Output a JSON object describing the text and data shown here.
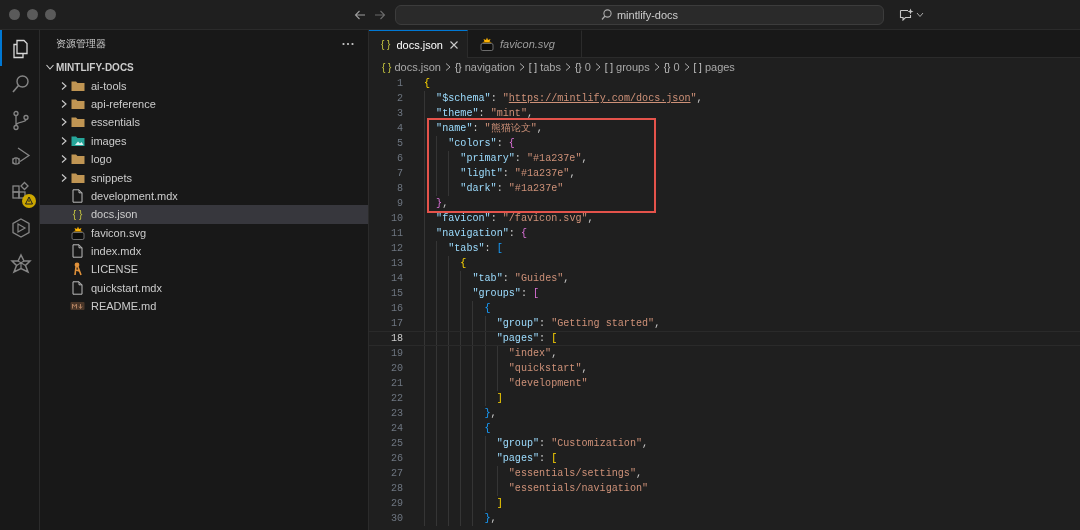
{
  "titlebar": {
    "command_center": "mintlify-docs"
  },
  "activity_bar": [
    {
      "kind": "explorer",
      "selected": true,
      "warning": false
    },
    {
      "kind": "search",
      "selected": false,
      "warning": false
    },
    {
      "kind": "source-control",
      "selected": false,
      "warning": false
    },
    {
      "kind": "run-debug",
      "selected": false,
      "warning": false
    },
    {
      "kind": "extensions",
      "selected": false,
      "warning": true
    },
    {
      "kind": "hexagon",
      "selected": false,
      "warning": false
    },
    {
      "kind": "knot",
      "selected": false,
      "warning": false
    }
  ],
  "explorer": {
    "title": "资源管理器",
    "root": {
      "label": "MINTLIFY-DOCS",
      "kind": "root",
      "expanded": true,
      "selected": false,
      "children": [
        {
          "label": "ai-tools",
          "kind": "folder",
          "expanded": false,
          "selected": false
        },
        {
          "label": "api-reference",
          "kind": "folder",
          "expanded": false,
          "selected": false
        },
        {
          "label": "essentials",
          "kind": "folder",
          "expanded": false,
          "selected": false
        },
        {
          "label": "images",
          "kind": "image-folder",
          "expanded": false,
          "selected": false
        },
        {
          "label": "logo",
          "kind": "folder",
          "expanded": false,
          "selected": false
        },
        {
          "label": "snippets",
          "kind": "folder",
          "expanded": false,
          "selected": false
        },
        {
          "label": "development.mdx",
          "kind": "file",
          "selected": false
        },
        {
          "label": "docs.json",
          "kind": "json",
          "glyph": "{ }",
          "selected": true
        },
        {
          "label": "favicon.svg",
          "kind": "svg",
          "selected": false
        },
        {
          "label": "index.mdx",
          "kind": "file",
          "selected": false
        },
        {
          "label": "LICENSE",
          "kind": "license",
          "selected": false
        },
        {
          "label": "quickstart.mdx",
          "kind": "file",
          "selected": false
        },
        {
          "label": "README.md",
          "kind": "markdown",
          "selected": false
        }
      ]
    }
  },
  "editor": {
    "tabs": [
      {
        "label": "docs.json",
        "kind": "json",
        "glyph": "{ }",
        "selected": true,
        "preview": false
      },
      {
        "label": "favicon.svg",
        "kind": "svg",
        "selected": false,
        "preview": true
      }
    ],
    "breadcrumbs": [
      {
        "glyph": "{ }",
        "label": "docs.json"
      },
      {
        "glyph": "{}",
        "label": "navigation"
      },
      {
        "glyph": "[ ]",
        "label": "tabs"
      },
      {
        "glyph": "{}",
        "label": "0"
      },
      {
        "glyph": "[ ]",
        "label": "groups"
      },
      {
        "glyph": "{}",
        "label": "0"
      },
      {
        "glyph": "[ ]",
        "label": "pages"
      }
    ],
    "lines": [
      {
        "number": "1",
        "current": false,
        "boxed": false,
        "tokens": [
          {
            "kind": "brace1",
            "text": "{"
          }
        ]
      },
      {
        "number": "2",
        "current": false,
        "boxed": false,
        "tokens": [
          {
            "kind": "key",
            "text": "  \"$schema\""
          },
          {
            "kind": "punct",
            "text": ": "
          },
          {
            "kind": "string",
            "text": "\""
          },
          {
            "kind": "link",
            "text": "https://mintlify.com/docs.json"
          },
          {
            "kind": "string",
            "text": "\""
          },
          {
            "kind": "punct",
            "text": ","
          }
        ]
      },
      {
        "number": "3",
        "current": false,
        "boxed": false,
        "tokens": [
          {
            "kind": "key",
            "text": "  \"theme\""
          },
          {
            "kind": "punct",
            "text": ": "
          },
          {
            "kind": "string",
            "text": "\"mint\""
          },
          {
            "kind": "punct",
            "text": ","
          }
        ]
      },
      {
        "number": "4",
        "current": false,
        "boxed": true,
        "tokens": [
          {
            "kind": "key",
            "text": "  \"name\""
          },
          {
            "kind": "punct",
            "text": ": "
          },
          {
            "kind": "string",
            "text": "\"熊猫论文\""
          },
          {
            "kind": "punct",
            "text": ","
          }
        ]
      },
      {
        "number": "5",
        "current": false,
        "boxed": true,
        "tokens": [
          {
            "kind": "key",
            "text": "    \"colors\""
          },
          {
            "kind": "punct",
            "text": ": "
          },
          {
            "kind": "brace2",
            "text": "{"
          }
        ]
      },
      {
        "number": "6",
        "current": false,
        "boxed": true,
        "tokens": [
          {
            "kind": "key",
            "text": "      \"primary\""
          },
          {
            "kind": "punct",
            "text": ": "
          },
          {
            "kind": "string",
            "text": "\"#1a237e\""
          },
          {
            "kind": "punct",
            "text": ","
          }
        ]
      },
      {
        "number": "7",
        "current": false,
        "boxed": true,
        "tokens": [
          {
            "kind": "key",
            "text": "      \"light\""
          },
          {
            "kind": "punct",
            "text": ": "
          },
          {
            "kind": "string",
            "text": "\"#1a237e\""
          },
          {
            "kind": "punct",
            "text": ","
          }
        ]
      },
      {
        "number": "8",
        "current": false,
        "boxed": true,
        "tokens": [
          {
            "kind": "key",
            "text": "      \"dark\""
          },
          {
            "kind": "punct",
            "text": ": "
          },
          {
            "kind": "string",
            "text": "\"#1a237e\""
          }
        ]
      },
      {
        "number": "9",
        "current": false,
        "boxed": true,
        "tokens": [
          {
            "kind": "brace2",
            "text": "  }"
          },
          {
            "kind": "punct",
            "text": ","
          }
        ]
      },
      {
        "number": "10",
        "current": false,
        "boxed": false,
        "tokens": [
          {
            "kind": "key",
            "text": "  \"favicon\""
          },
          {
            "kind": "punct",
            "text": ": "
          },
          {
            "kind": "string",
            "text": "\"/favicon.svg\""
          },
          {
            "kind": "punct",
            "text": ","
          }
        ]
      },
      {
        "number": "11",
        "current": false,
        "boxed": false,
        "tokens": [
          {
            "kind": "key",
            "text": "  \"navigation\""
          },
          {
            "kind": "punct",
            "text": ": "
          },
          {
            "kind": "brace2",
            "text": "{"
          }
        ]
      },
      {
        "number": "12",
        "current": false,
        "boxed": false,
        "tokens": [
          {
            "kind": "key",
            "text": "    \"tabs\""
          },
          {
            "kind": "punct",
            "text": ": "
          },
          {
            "kind": "brace3",
            "text": "["
          }
        ]
      },
      {
        "number": "13",
        "current": false,
        "boxed": false,
        "tokens": [
          {
            "kind": "brace1",
            "text": "      {"
          }
        ]
      },
      {
        "number": "14",
        "current": false,
        "boxed": false,
        "tokens": [
          {
            "kind": "key",
            "text": "        \"tab\""
          },
          {
            "kind": "punct",
            "text": ": "
          },
          {
            "kind": "string",
            "text": "\"Guides\""
          },
          {
            "kind": "punct",
            "text": ","
          }
        ]
      },
      {
        "number": "15",
        "current": false,
        "boxed": false,
        "tokens": [
          {
            "kind": "key",
            "text": "        \"groups\""
          },
          {
            "kind": "punct",
            "text": ": "
          },
          {
            "kind": "brace2",
            "text": "["
          }
        ]
      },
      {
        "number": "16",
        "current": false,
        "boxed": false,
        "tokens": [
          {
            "kind": "brace3",
            "text": "          {"
          }
        ]
      },
      {
        "number": "17",
        "current": false,
        "boxed": false,
        "tokens": [
          {
            "kind": "key",
            "text": "            \"group\""
          },
          {
            "kind": "punct",
            "text": ": "
          },
          {
            "kind": "string",
            "text": "\"Getting started\""
          },
          {
            "kind": "punct",
            "text": ","
          }
        ]
      },
      {
        "number": "18",
        "current": true,
        "boxed": false,
        "tokens": [
          {
            "kind": "key",
            "text": "            \"pages\""
          },
          {
            "kind": "punct",
            "text": ": "
          },
          {
            "kind": "brace1",
            "text": "["
          }
        ]
      },
      {
        "number": "19",
        "current": false,
        "boxed": false,
        "tokens": [
          {
            "kind": "string",
            "text": "              \"index\""
          },
          {
            "kind": "punct",
            "text": ","
          }
        ]
      },
      {
        "number": "20",
        "current": false,
        "boxed": false,
        "tokens": [
          {
            "kind": "string",
            "text": "              \"quickstart\""
          },
          {
            "kind": "punct",
            "text": ","
          }
        ]
      },
      {
        "number": "21",
        "current": false,
        "boxed": false,
        "tokens": [
          {
            "kind": "string",
            "text": "              \"development\""
          }
        ]
      },
      {
        "number": "22",
        "current": false,
        "boxed": false,
        "tokens": [
          {
            "kind": "brace1",
            "text": "            ]"
          }
        ]
      },
      {
        "number": "23",
        "current": false,
        "boxed": false,
        "tokens": [
          {
            "kind": "brace3",
            "text": "          }"
          },
          {
            "kind": "punct",
            "text": ","
          }
        ]
      },
      {
        "number": "24",
        "current": false,
        "boxed": false,
        "tokens": [
          {
            "kind": "brace3",
            "text": "          {"
          }
        ]
      },
      {
        "number": "25",
        "current": false,
        "boxed": false,
        "tokens": [
          {
            "kind": "key",
            "text": "            \"group\""
          },
          {
            "kind": "punct",
            "text": ": "
          },
          {
            "kind": "string",
            "text": "\"Customization\""
          },
          {
            "kind": "punct",
            "text": ","
          }
        ]
      },
      {
        "number": "26",
        "current": false,
        "boxed": false,
        "tokens": [
          {
            "kind": "key",
            "text": "            \"pages\""
          },
          {
            "kind": "punct",
            "text": ": "
          },
          {
            "kind": "brace1",
            "text": "["
          }
        ]
      },
      {
        "number": "27",
        "current": false,
        "boxed": false,
        "tokens": [
          {
            "kind": "string",
            "text": "              \"essentials/settings\""
          },
          {
            "kind": "punct",
            "text": ","
          }
        ]
      },
      {
        "number": "28",
        "current": false,
        "boxed": false,
        "tokens": [
          {
            "kind": "string",
            "text": "              \"essentials/navigation\""
          }
        ]
      },
      {
        "number": "29",
        "current": false,
        "boxed": false,
        "tokens": [
          {
            "kind": "brace1",
            "text": "            ]"
          }
        ]
      },
      {
        "number": "30",
        "current": false,
        "boxed": false,
        "tokens": [
          {
            "kind": "brace3",
            "text": "          }"
          },
          {
            "kind": "punct",
            "text": ","
          }
        ]
      }
    ]
  }
}
